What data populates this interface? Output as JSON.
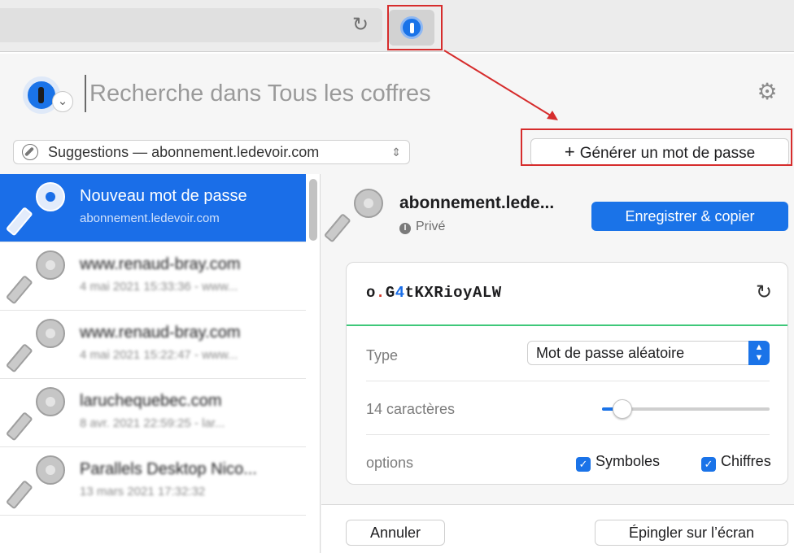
{
  "browser": {
    "reload_icon": "reload-icon",
    "extension_icon": "1password-icon"
  },
  "header": {
    "search_placeholder": "Recherche dans Tous les coffres",
    "settings_icon": "gear-icon"
  },
  "filter": {
    "suggestions_label": "Suggestions — abonnement.ledevoir.com",
    "generate_label": "Générer un mot de passe"
  },
  "list": {
    "items": [
      {
        "title": "Nouveau mot de passe",
        "subtitle": "abonnement.ledevoir.com"
      },
      {
        "title": "www.renaud-bray.com",
        "subtitle": "4 mai 2021 15:33:36 - www..."
      },
      {
        "title": "www.renaud-bray.com",
        "subtitle": "4 mai 2021 15:22:47 - www..."
      },
      {
        "title": "laruchequebec.com",
        "subtitle": "8 avr. 2021 22:59:25 - lar..."
      },
      {
        "title": "Parallels Desktop Nico...",
        "subtitle": "13 mars 2021 17:32:32"
      }
    ]
  },
  "detail": {
    "title": "abonnement.lede...",
    "vault": "Privé",
    "save_copy_label": "Enregistrer & copier",
    "password": {
      "p1": "o",
      "p2": ".",
      "p3": "G",
      "p4": "4",
      "p5": "tKXRioyALW"
    },
    "type_label": "Type",
    "type_value": "Mot de passe aléatoire",
    "length_label": "14 caractères",
    "length_fraction": 0.12,
    "options_label": "options",
    "symbols_label": "Symboles",
    "digits_label": "Chiffres",
    "cancel_label": "Annuler",
    "pin_label": "Épingler sur l’écran"
  },
  "colors": {
    "accent": "#1a73e8",
    "selected_row": "#1a6ee8",
    "strength_bar": "#3fc87a",
    "annotation": "#d62c2c"
  }
}
